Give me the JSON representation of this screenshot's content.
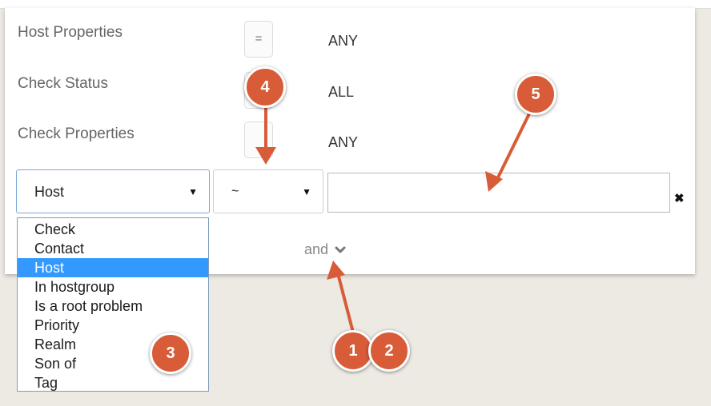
{
  "filter_panel": {
    "rows": [
      {
        "label": "Host Properties",
        "operator": "=",
        "value": "ANY"
      },
      {
        "label": "Check Status",
        "value": "ALL"
      },
      {
        "label": "Check Properties",
        "value": "ANY"
      }
    ],
    "field_select": {
      "selected": "Host"
    },
    "operator_select": {
      "selected": "~"
    },
    "value_input": {
      "value": ""
    },
    "remove_icon": "times-icon",
    "and_toggle": {
      "label": "and",
      "icon": "chevron-down-icon"
    }
  },
  "field_dropdown": {
    "options": [
      "Check",
      "Contact",
      "Host",
      "In hostgroup",
      "Is a root problem",
      "Priority",
      "Realm",
      "Son of",
      "Tag"
    ],
    "selected": "Host"
  },
  "callouts": [
    "1",
    "2",
    "3",
    "4",
    "5"
  ],
  "colors": {
    "callout": "#d85c38",
    "selection": "#3399ff",
    "focus_border": "#7aa6d9"
  }
}
